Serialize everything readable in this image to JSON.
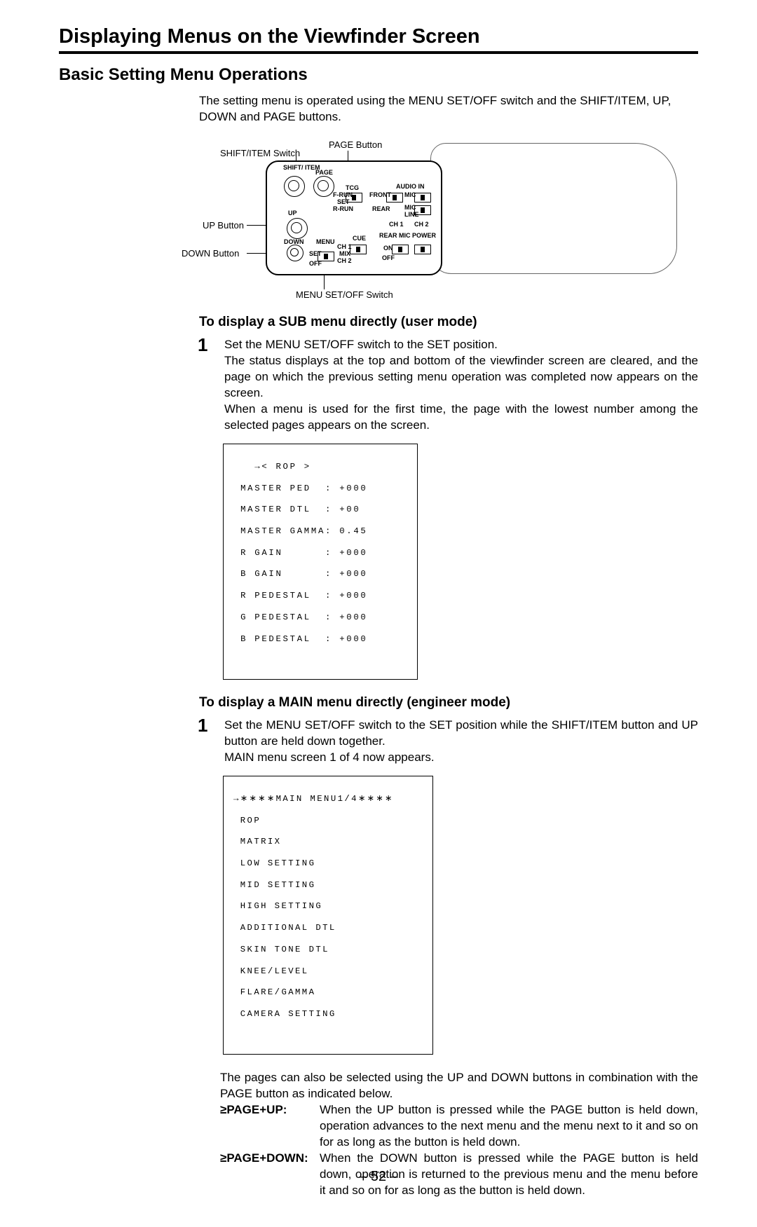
{
  "title": "Displaying Menus on the Viewfinder Screen",
  "h2": "Basic Setting Menu Operations",
  "intro": "The setting menu is operated using the MENU SET/OFF switch and the SHIFT/ITEM, UP, DOWN and PAGE buttons.",
  "diagram": {
    "page_button": "PAGE Button",
    "shift_item_switch": "SHIFT/ITEM Switch",
    "up_button": "UP Button",
    "down_button": "DOWN Button",
    "menu_set_off_switch": "MENU SET/OFF Switch",
    "panel": {
      "shift_item": "SHIFT/\nITEM",
      "page": "PAGE",
      "tcg": "TCG",
      "audio_in": "AUDIO IN",
      "f_run": "F-RUN",
      "set": "SET",
      "r_run": "R-RUN",
      "front": "FRONT",
      "rear": "REAR",
      "mic": "MIC",
      "line": "LINE",
      "up": "UP",
      "ch1": "CH 1",
      "ch2": "CH 2",
      "down": "DOWN",
      "menu": "MENU",
      "set2": "SET",
      "off": "OFF",
      "cue": "CUE",
      "ch1b": "CH 1",
      "mix": "MIX",
      "ch2b": "CH 2",
      "rear_mic_power": "REAR MIC POWER",
      "on": "ON",
      "off2": "OFF"
    }
  },
  "h3_sub": "To display a SUB menu directly (user mode)",
  "step1_num": "1",
  "step1_sub": "Set the MENU SET/OFF switch to the SET position.\nThe status displays at the top and bottom of the viewfinder screen are cleared, and the page on which the previous setting menu operation was completed now appears on the screen.\nWhen a menu is used for the first time, the page with the lowest number among the selected pages appears on the screen.",
  "rop_screen": {
    "header": "   →< ROP >",
    "rows": [
      " MASTER PED  : +000",
      " MASTER DTL  : +00",
      " MASTER GAMMA: 0.45",
      " R GAIN      : +000",
      " B GAIN      : +000",
      " R PEDESTAL  : +000",
      " G PEDESTAL  : +000",
      " B PEDESTAL  : +000"
    ]
  },
  "h3_main": "To display a MAIN menu directly (engineer mode)",
  "step1_main": "Set the MENU SET/OFF switch to the SET position while the SHIFT/ITEM button and UP button are held down together.\nMAIN menu screen 1 of 4 now appears.",
  "main_screen": {
    "header": "→∗∗∗∗MAIN MENU1/4∗∗∗∗",
    "rows": [
      " ROP",
      " MATRIX",
      " LOW SETTING",
      " MID SETTING",
      " HIGH SETTING",
      " ADDITIONAL DTL",
      " SKIN TONE DTL",
      " KNEE/LEVEL",
      " FLARE/GAMMA",
      " CAMERA SETTING"
    ]
  },
  "post_para": "The pages can also be selected using the UP and DOWN buttons in combination with the PAGE button as indicated below.",
  "bullets": {
    "page_up_label": "≥PAGE+UP:",
    "page_up_desc": "When the UP button is pressed while the PAGE button is held down, operation advances to the next menu and the menu next to it and so on for as long as the button is held down.",
    "page_down_label": "≥PAGE+DOWN:",
    "page_down_desc": "When the DOWN button is pressed while the PAGE button is held down, operation is returned to the previous menu and the menu before it and so on for as long as the button is held down."
  },
  "pagenum": "– 52 –"
}
